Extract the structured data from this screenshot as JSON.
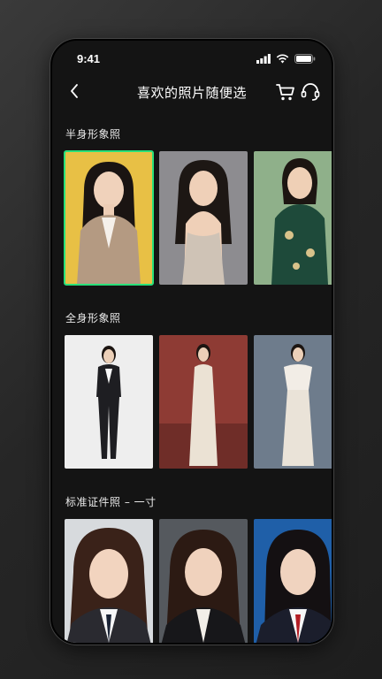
{
  "status_bar": {
    "time": "9:41"
  },
  "header": {
    "title": "喜欢的照片随便选"
  },
  "sections": [
    {
      "title": "半身形象照"
    },
    {
      "title": "全身形象照"
    },
    {
      "title": "标准证件照 – 一寸"
    }
  ],
  "colors": {
    "accent_selected": "#29e07a",
    "page_bg": "#141414"
  },
  "icons": [
    "back-icon",
    "cart-icon",
    "headset-icon",
    "signal-icon",
    "wifi-icon",
    "battery-icon"
  ]
}
